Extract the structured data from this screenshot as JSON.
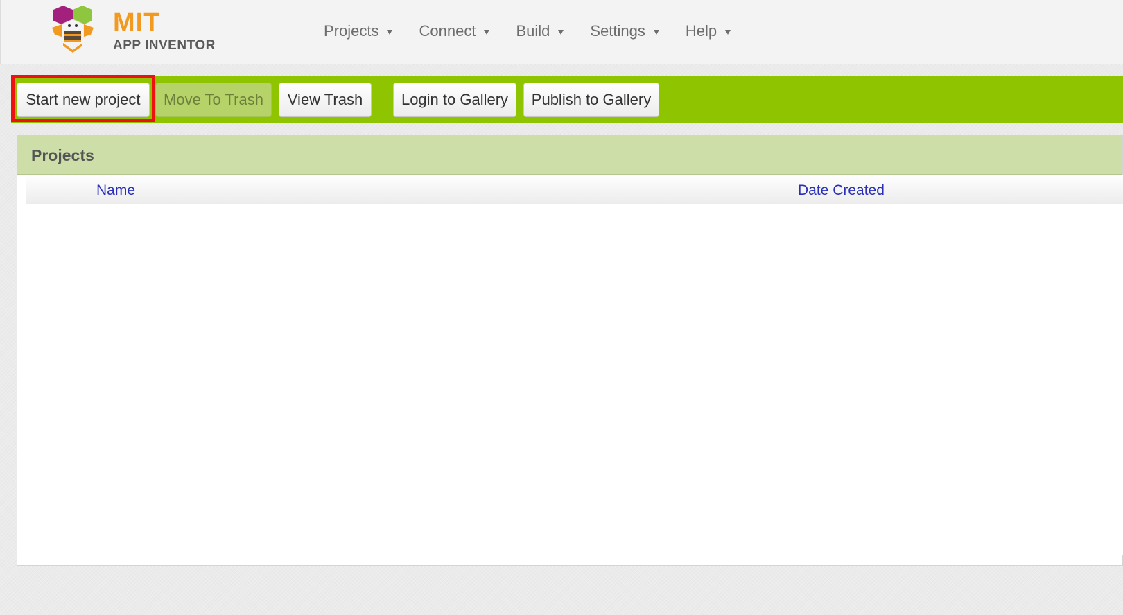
{
  "app": {
    "logo_title": "MIT",
    "logo_subtitle": "APP INVENTOR"
  },
  "topnav": [
    {
      "label": "Projects"
    },
    {
      "label": "Connect"
    },
    {
      "label": "Build"
    },
    {
      "label": "Settings"
    },
    {
      "label": "Help"
    }
  ],
  "toolbar": {
    "start_new_project": "Start new project",
    "move_to_trash": "Move To Trash",
    "view_trash": "View Trash",
    "login_to_gallery": "Login to Gallery",
    "publish_to_gallery": "Publish to Gallery"
  },
  "projects_panel": {
    "title": "Projects",
    "columns": [
      "Name",
      "Date Created"
    ],
    "rows": []
  },
  "colors": {
    "toolbar_green": "#8fc400",
    "panel_header": "#cddea9",
    "highlight_red": "#ee1111",
    "link_blue": "#2a2fb8",
    "logo_orange": "#f29a1f"
  },
  "icons": {
    "logo": "app-inventor-bee-logo-icon",
    "dropdown": "caret-down-icon"
  }
}
